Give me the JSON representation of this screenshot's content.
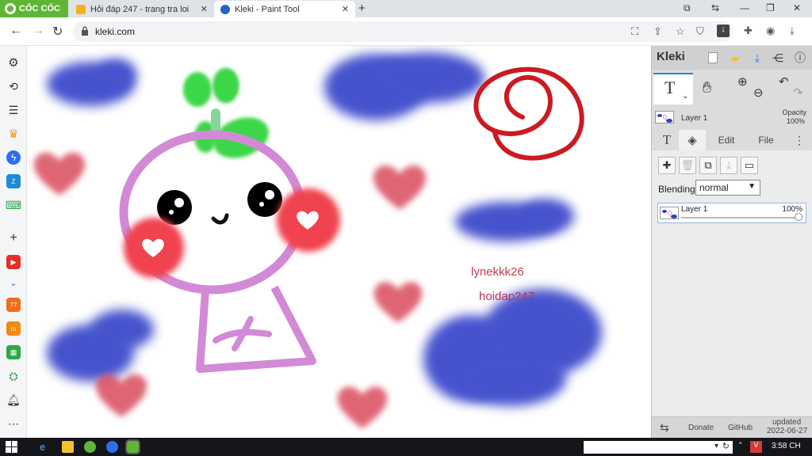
{
  "browser": {
    "brand": "CỐC CỐC",
    "tabs": [
      {
        "title": "Hỏi đáp 247 - trang tra loi",
        "active": false
      },
      {
        "title": "Kleki - Paint Tool",
        "active": true
      }
    ],
    "url": "kleki.com"
  },
  "canvas": {
    "texts": [
      "lynekkk26",
      "hoidap247"
    ],
    "colors": {
      "blue": "#3340c8",
      "pink_heart": "#d94b5c",
      "outline": "#d38ad6",
      "sprout": "#3dd64a",
      "spiral": "#cc1a22",
      "cheek": "#f0424f"
    }
  },
  "kleki": {
    "logo": "Kleki",
    "tool_letter": "T",
    "layer_name": "Layer 1",
    "opacity_label": "Opacity",
    "opacity_value": "100%",
    "tabs": [
      "T",
      "layers-icon",
      "Edit",
      "File"
    ],
    "blending_label": "Blending",
    "blending_value": "normal",
    "layers": [
      {
        "name": "Layer 1",
        "opacity": "100%"
      }
    ],
    "footer": {
      "donate": "Donate",
      "github": "GitHub",
      "updated_label": "updated",
      "updated_date": "2022-06-27"
    }
  },
  "taskbar": {
    "time": "3:58 CH"
  }
}
